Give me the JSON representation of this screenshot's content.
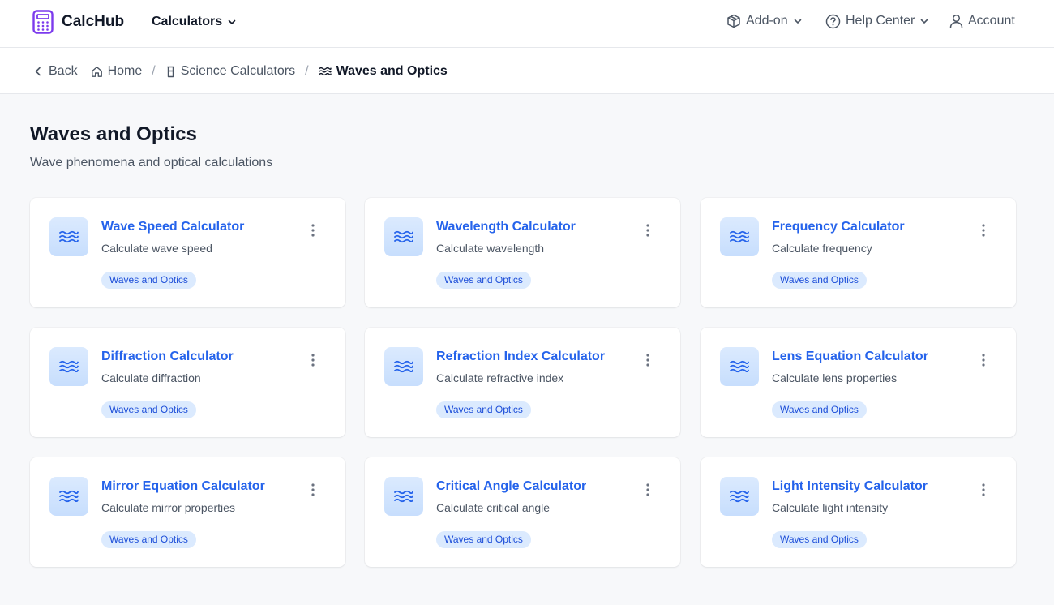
{
  "header": {
    "brand": "CalcHub",
    "calculators_menu": "Calculators",
    "addon": "Add-on",
    "help_center": "Help Center",
    "account": "Account"
  },
  "breadcrumb": {
    "back": "Back",
    "home": "Home",
    "science": "Science Calculators",
    "current": "Waves and Optics"
  },
  "page": {
    "title": "Waves and Optics",
    "subtitle": "Wave phenomena and optical calculations"
  },
  "colors": {
    "accent": "#2563eb",
    "tag_bg": "#dbeafe",
    "logo": "#7c3aed"
  },
  "cards": [
    {
      "title": "Wave Speed Calculator",
      "desc": "Calculate wave speed",
      "tag": "Waves and Optics"
    },
    {
      "title": "Wavelength Calculator",
      "desc": "Calculate wavelength",
      "tag": "Waves and Optics"
    },
    {
      "title": "Frequency Calculator",
      "desc": "Calculate frequency",
      "tag": "Waves and Optics"
    },
    {
      "title": "Diffraction Calculator",
      "desc": "Calculate diffraction",
      "tag": "Waves and Optics"
    },
    {
      "title": "Refraction Index Calculator",
      "desc": "Calculate refractive index",
      "tag": "Waves and Optics"
    },
    {
      "title": "Lens Equation Calculator",
      "desc": "Calculate lens properties",
      "tag": "Waves and Optics"
    },
    {
      "title": "Mirror Equation Calculator",
      "desc": "Calculate mirror properties",
      "tag": "Waves and Optics"
    },
    {
      "title": "Critical Angle Calculator",
      "desc": "Calculate critical angle",
      "tag": "Waves and Optics"
    },
    {
      "title": "Light Intensity Calculator",
      "desc": "Calculate light intensity",
      "tag": "Waves and Optics"
    }
  ]
}
